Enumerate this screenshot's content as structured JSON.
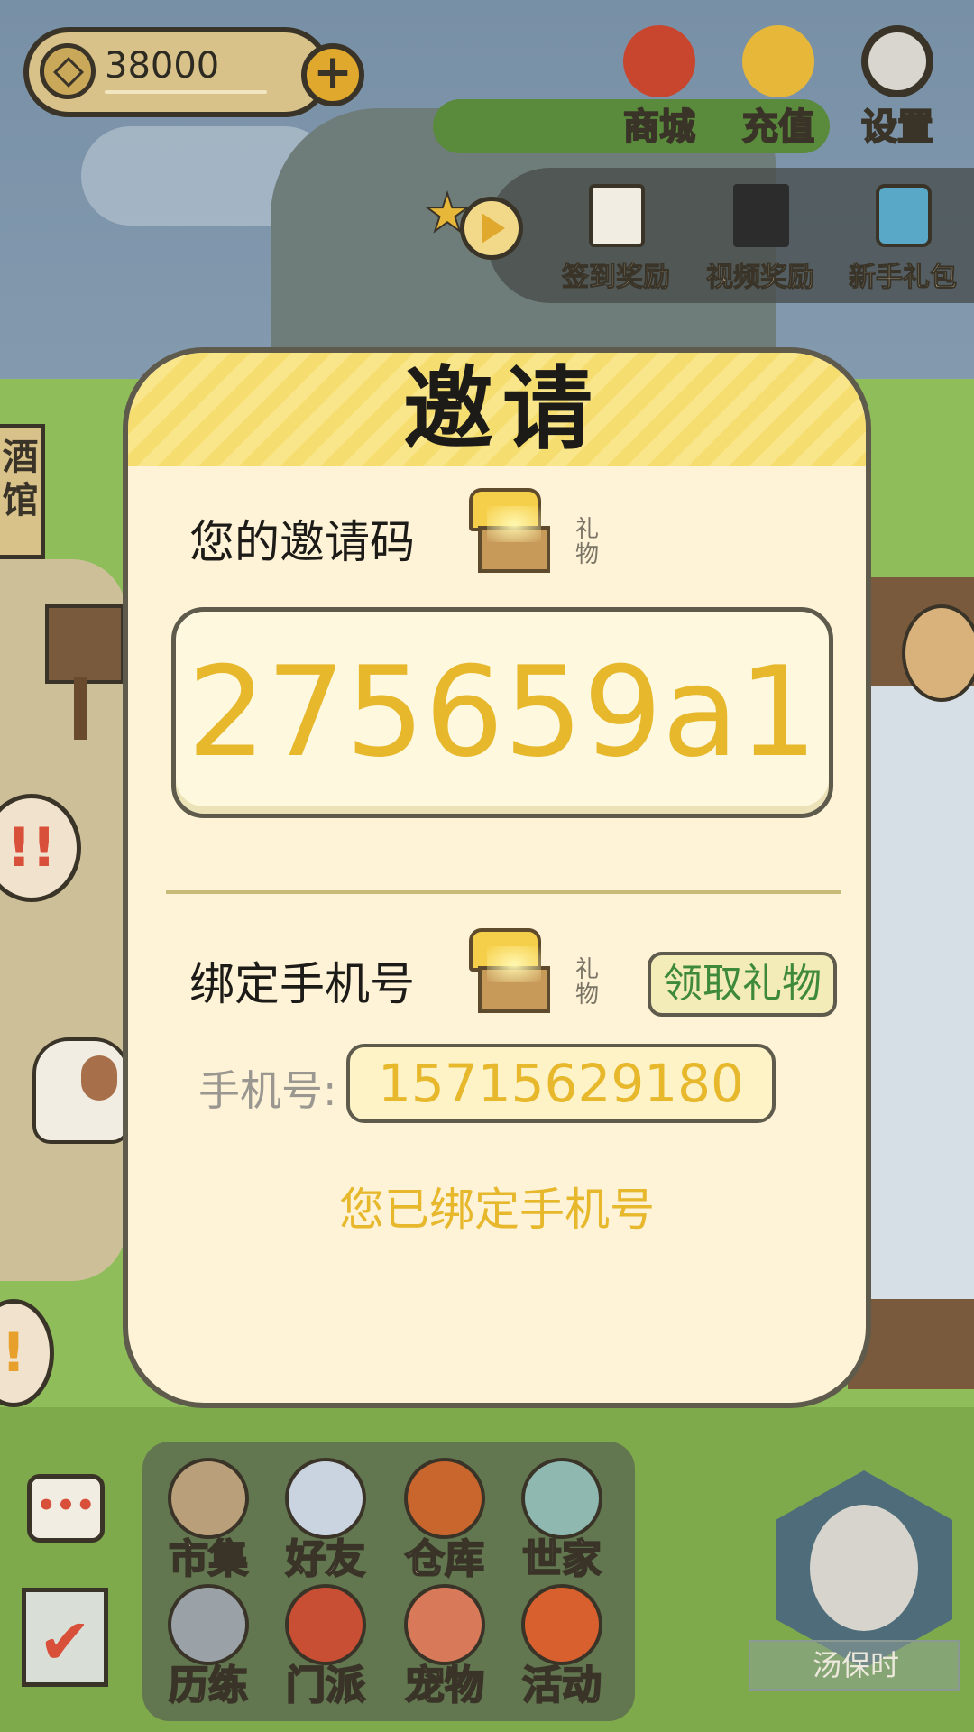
{
  "hud": {
    "coins": "38000",
    "add_coin_label": "+",
    "shop_label": "商城",
    "recharge_label": "充值",
    "settings_label": "设置"
  },
  "rewards": {
    "signin_label": "签到奖励",
    "video_label": "视频奖励",
    "newbie_label": "新手礼包"
  },
  "side": {
    "tavern_label": "酒馆",
    "bubble1": "!!",
    "bubble2": "!"
  },
  "dialog": {
    "title": "邀请",
    "invite_code_label": "您的邀请码",
    "gift_tag": "礼物",
    "invite_code": "275659a1",
    "bind_phone_label": "绑定手机号",
    "claim_gift_button": "领取礼物",
    "phone_field_label": "手机号:",
    "phone_value": "15715629180",
    "bound_message": "您已绑定手机号"
  },
  "menu": {
    "items": [
      {
        "label": "市集",
        "icon": "market-icon"
      },
      {
        "label": "好友",
        "icon": "friends-icon"
      },
      {
        "label": "仓库",
        "icon": "storage-icon"
      },
      {
        "label": "世家",
        "icon": "family-icon"
      },
      {
        "label": "历练",
        "icon": "training-icon"
      },
      {
        "label": "门派",
        "icon": "sect-icon"
      },
      {
        "label": "宠物",
        "icon": "pet-icon"
      },
      {
        "label": "活动",
        "icon": "event-icon"
      }
    ]
  },
  "chat": {
    "icon_text": "•••"
  },
  "task": {
    "icon_text": "✔"
  },
  "player": {
    "name": "汤保时"
  },
  "colors": {
    "accent_yellow": "#e7b72c",
    "claim_green": "#3f8a3a",
    "dialog_bg": "#fef3d6",
    "header_yellow": "#fae68a"
  }
}
